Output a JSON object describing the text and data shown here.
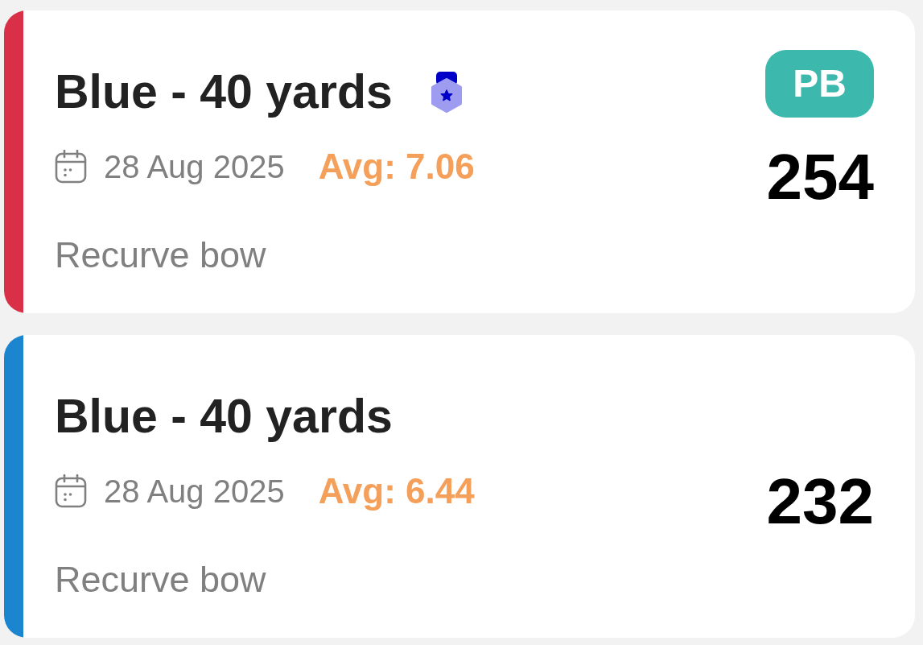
{
  "sessions": [
    {
      "title": "Blue - 40 yards",
      "medal": true,
      "date": "28 Aug 2025",
      "average": "Avg: 7.06",
      "equipment": "Recurve bow",
      "badge": "PB",
      "score": "254",
      "color": "#d92f47"
    },
    {
      "title": "Blue - 40 yards",
      "medal": false,
      "date": "28 Aug 2025",
      "average": "Avg: 6.44",
      "equipment": "Recurve bow",
      "score": "232",
      "color": "#1b85d0"
    }
  ]
}
